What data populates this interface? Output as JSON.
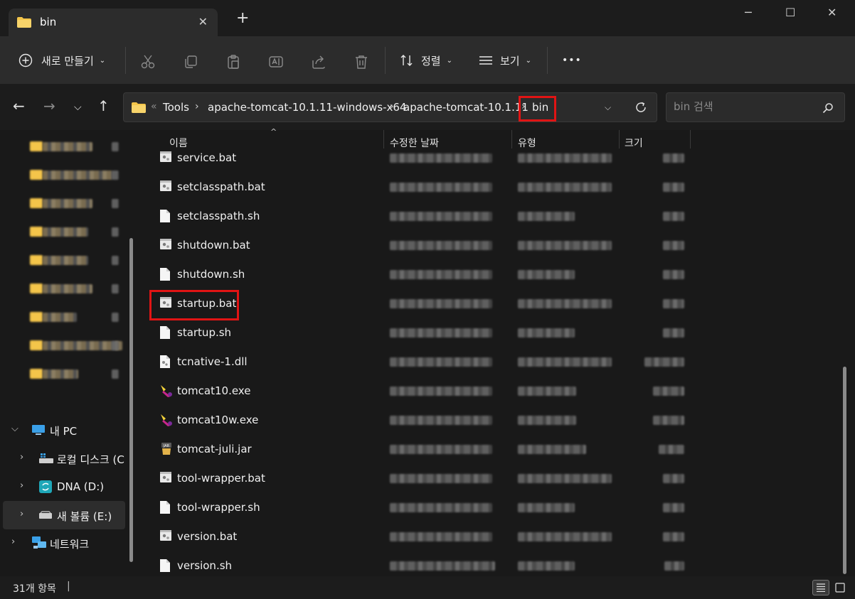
{
  "window": {
    "tab_title": "bin",
    "new_tab": "+",
    "minimize": "─",
    "maximize": "☐",
    "close": "✕"
  },
  "toolbar": {
    "new_label": "새로 만들기",
    "sort_label": "정렬",
    "view_label": "보기",
    "more_label": "•••"
  },
  "address": {
    "overflow": "«",
    "crumbs": [
      "Tools",
      "apache-tomcat-10.1.11-windows-x64",
      "apache-tomcat-10.1.11",
      "bin"
    ]
  },
  "search": {
    "placeholder": "bin 검색"
  },
  "nav": {
    "this_pc": "내 PC",
    "local_disk": "로컬 디스크 (C:)",
    "dna": "DNA (D:)",
    "new_volume": "새 볼륨 (E:)",
    "network": "네트워크"
  },
  "columns": {
    "name": "이름",
    "date": "수정한 날짜",
    "type": "유형",
    "size": "크기"
  },
  "files": [
    {
      "name": "service.bat",
      "icon": "batch-file-icon"
    },
    {
      "name": "setclasspath.bat",
      "icon": "batch-file-icon"
    },
    {
      "name": "setclasspath.sh",
      "icon": "document-file-icon"
    },
    {
      "name": "shutdown.bat",
      "icon": "batch-file-icon"
    },
    {
      "name": "shutdown.sh",
      "icon": "document-file-icon"
    },
    {
      "name": "startup.bat",
      "icon": "batch-file-icon"
    },
    {
      "name": "startup.sh",
      "icon": "document-file-icon"
    },
    {
      "name": "tcnative-1.dll",
      "icon": "dll-file-icon"
    },
    {
      "name": "tomcat10.exe",
      "icon": "tomcat-exe-icon"
    },
    {
      "name": "tomcat10w.exe",
      "icon": "tomcat-exe-icon"
    },
    {
      "name": "tomcat-juli.jar",
      "icon": "jar-file-icon"
    },
    {
      "name": "tool-wrapper.bat",
      "icon": "batch-file-icon"
    },
    {
      "name": "tool-wrapper.sh",
      "icon": "document-file-icon"
    },
    {
      "name": "version.bat",
      "icon": "batch-file-icon"
    },
    {
      "name": "version.sh",
      "icon": "document-file-icon"
    }
  ],
  "status": {
    "item_count": "31개 항목"
  },
  "colors": {
    "highlight": "#e11414",
    "folder": "#f4c54a",
    "background": "#191919"
  }
}
